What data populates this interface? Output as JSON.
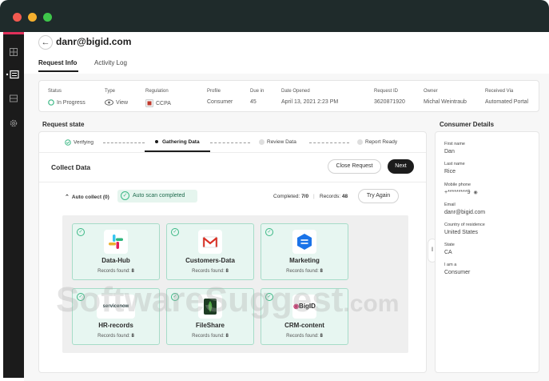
{
  "header": {
    "title": "danr@bigid.com",
    "tabs": [
      {
        "label": "Request Info",
        "active": true
      },
      {
        "label": "Activity Log",
        "active": false
      }
    ]
  },
  "request_info": {
    "status": {
      "label": "Status",
      "value": "In Progress"
    },
    "type": {
      "label": "Type",
      "value": "View"
    },
    "regulation": {
      "label": "Regulation",
      "value": "CCPA"
    },
    "profile": {
      "label": "Profile",
      "value": "Consumer"
    },
    "due_in": {
      "label": "Due in",
      "value": "45"
    },
    "date_opened": {
      "label": "Date Opened",
      "value": "April 13, 2021 2:23 PM"
    },
    "request_id": {
      "label": "Request ID",
      "value": "3620871920"
    },
    "owner": {
      "label": "Owner",
      "value": "Michal Weintraub"
    },
    "received_via": {
      "label": "Received Via",
      "value": "Automated Portal"
    }
  },
  "request_state": {
    "title": "Request state",
    "steps": [
      {
        "label": "Verifying",
        "status": "done"
      },
      {
        "label": "Gathering Data",
        "status": "active"
      },
      {
        "label": "Review Data",
        "status": "pending"
      },
      {
        "label": "Report Ready",
        "status": "pending"
      }
    ],
    "collect": {
      "title": "Collect Data",
      "close_label": "Close Request",
      "next_label": "Next",
      "auto_collect_label": "Auto collect (0)",
      "scan_status": "Auto scan completed",
      "completed_label": "Completed:",
      "completed_value": "7/0",
      "records_label": "Records:",
      "records_value": "48",
      "try_again_label": "Try Again"
    },
    "sources": [
      {
        "name": "Data-Hub",
        "records_label": "Records found:",
        "records": "8",
        "icon": "slack-icon"
      },
      {
        "name": "Customers-Data",
        "records_label": "Records found:",
        "records": "8",
        "icon": "gmail-icon"
      },
      {
        "name": "Marketing",
        "records_label": "Records found:",
        "records": "8",
        "icon": "exchange-icon"
      },
      {
        "name": "HR-records",
        "records_label": "Records found:",
        "records": "8",
        "icon": "servicenow-icon",
        "logo_text": "servicenow"
      },
      {
        "name": "FileShare",
        "records_label": "Records found:",
        "records": "8",
        "icon": "mongodb-icon"
      },
      {
        "name": "CRM-content",
        "records_label": "Records found:",
        "records": "8",
        "icon": "bigid-icon",
        "logo_text": "BigID"
      }
    ]
  },
  "consumer_details": {
    "title": "Consumer Details",
    "fields": [
      {
        "label": "First name",
        "value": "Dan"
      },
      {
        "label": "Last name",
        "value": "Rice"
      },
      {
        "label": "Mobile phone",
        "value": "+*********9"
      },
      {
        "label": "Email",
        "value": "danr@bigid.com"
      },
      {
        "label": "Country of residence",
        "value": "United States"
      },
      {
        "label": "State",
        "value": "CA"
      },
      {
        "label": "I am a",
        "value": "Consumer"
      }
    ]
  },
  "watermark": {
    "main": "SoftwareSuggest",
    "suffix": ".com"
  },
  "colors": {
    "titlebar": "#1f2b2b",
    "sidebar": "#1b1b1b",
    "accent": "#e0305a",
    "success_bg": "#e7f6f1",
    "success_border": "#a6dcc8",
    "success_icon": "#3bb885"
  }
}
